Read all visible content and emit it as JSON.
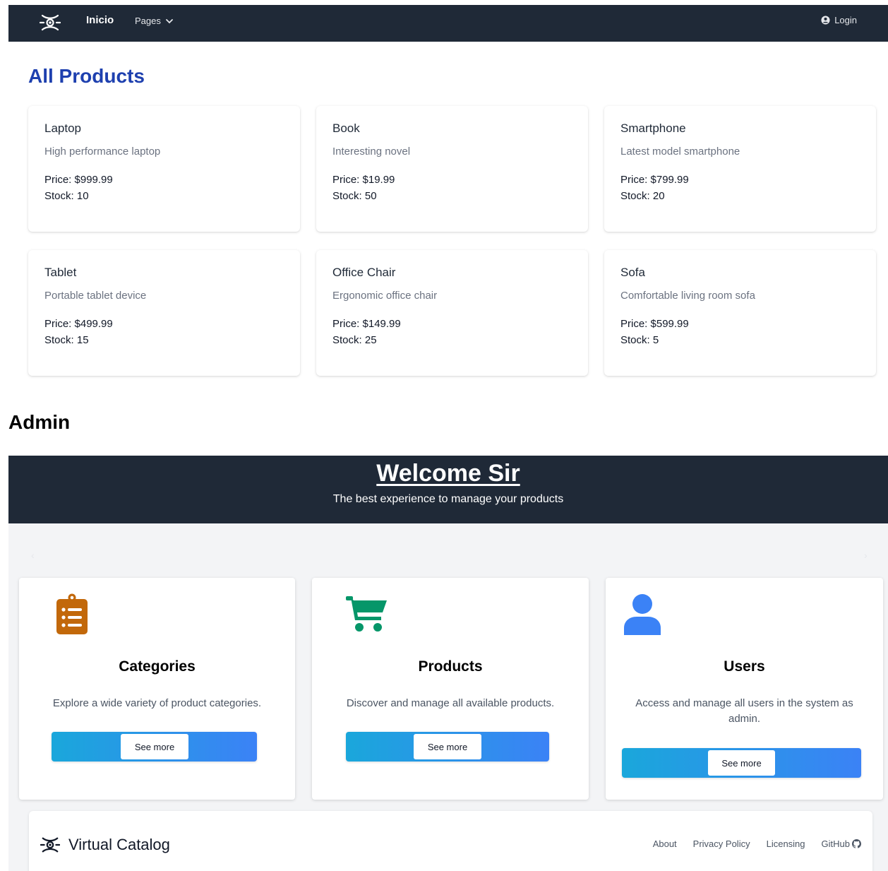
{
  "navbar": {
    "home_label": "Inicio",
    "pages_label": "Pages",
    "login_label": "Login"
  },
  "products_section": {
    "title": "All Products",
    "products": [
      {
        "name": "Laptop",
        "description": "High performance laptop",
        "price": "Price: $999.99",
        "stock": "Stock: 10"
      },
      {
        "name": "Book",
        "description": "Interesting novel",
        "price": "Price: $19.99",
        "stock": "Stock: 50"
      },
      {
        "name": "Smartphone",
        "description": "Latest model smartphone",
        "price": "Price: $799.99",
        "stock": "Stock: 20"
      },
      {
        "name": "Tablet",
        "description": "Portable tablet device",
        "price": "Price: $499.99",
        "stock": "Stock: 15"
      },
      {
        "name": "Office Chair",
        "description": "Ergonomic office chair",
        "price": "Price: $149.99",
        "stock": "Stock: 25"
      },
      {
        "name": "Sofa",
        "description": "Comfortable living room sofa",
        "price": "Price: $599.99",
        "stock": "Stock: 5"
      }
    ]
  },
  "admin_section": {
    "title": "Admin",
    "hero_title": "Welcome Sir",
    "hero_subtitle": "The best experience to manage your products",
    "carousel_prev": "‹",
    "carousel_next": "›",
    "cards": [
      {
        "title": "Categories",
        "description": "Explore a wide variety of product categories.",
        "button_label": "See more",
        "icon": "clipboard-list-icon",
        "icon_color": "#c2680a"
      },
      {
        "title": "Products",
        "description": "Discover and manage all available products.",
        "button_label": "See more",
        "icon": "shopping-cart-icon",
        "icon_color": "#059669"
      },
      {
        "title": "Users",
        "description": "Access and manage all users in the system as admin.",
        "button_label": "See more",
        "icon": "user-icon",
        "icon_color": "#3b82f6"
      }
    ]
  },
  "footer": {
    "brand": "Virtual Catalog",
    "links": [
      "About",
      "Privacy Policy",
      "Licensing",
      "GitHub"
    ]
  },
  "colors": {
    "navbar_bg": "#1f2937",
    "title_blue": "#1e40af",
    "button_gradient_start": "#1aa7db",
    "button_gradient_end": "#3b82f6"
  }
}
